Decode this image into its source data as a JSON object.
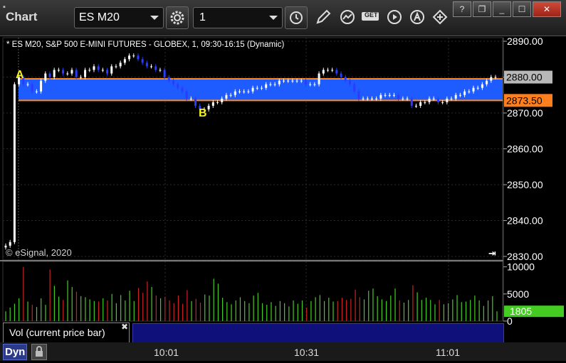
{
  "window": {
    "title": "Chart",
    "symbol": "ES M20",
    "interval": "1",
    "buttons": {
      "minimize": "_",
      "restore": "❐",
      "maximize": "☐",
      "close": "✕"
    }
  },
  "toolbar": {
    "tools": [
      "gear-icon",
      "clock-icon",
      "pencil-icon",
      "studies-icon",
      "get-icon",
      "play-icon",
      "alert-icon",
      "move-icon"
    ],
    "get_label": "GET"
  },
  "chart_data": [
    {
      "type": "candlestick",
      "header": "* ES M20, S&P 500 E-MINI FUTURES - GLOBEX, 1, 09:30-16:15 (Dynamic)",
      "copyright": "© eSignal, 2020",
      "y_ticks": [
        "2890.00",
        "2880.00",
        "2870.00",
        "2860.00",
        "2850.00",
        "2840.00",
        "2830.00"
      ],
      "y_tick_values": [
        2890,
        2880,
        2870,
        2860,
        2850,
        2840,
        2830
      ],
      "ylim": [
        2829,
        2891
      ],
      "x_ticks": [
        "10:01",
        "10:31",
        "11:01"
      ],
      "zone": {
        "upper": 2879.5,
        "lower": 2873.5,
        "color": "#1e5cff",
        "line_color": "#ff8a1e"
      },
      "price_tags": [
        {
          "label": "2880.00",
          "value": 2880.0,
          "bg": "#b8b8b8",
          "fg": "#000000"
        },
        {
          "label": "2873.50",
          "value": 2873.5,
          "bg": "#ff7f1e",
          "fg": "#000000"
        }
      ],
      "annotations": [
        {
          "text": "A",
          "color": "#f5f21e"
        },
        {
          "text": "B",
          "color": "#f5f21e"
        }
      ],
      "closes": [
        2833,
        2834,
        2878,
        2880,
        2878,
        2878,
        2876,
        2876,
        2879,
        2881,
        2880,
        2882,
        2882,
        2881,
        2881,
        2882,
        2880,
        2880,
        2882,
        2882,
        2883,
        2882,
        2882,
        2881,
        2883,
        2883,
        2884,
        2885,
        2886,
        2886,
        2885,
        2884,
        2883,
        2883,
        2882,
        2882,
        2880,
        2879,
        2878,
        2877,
        2876,
        2874,
        2874,
        2872,
        2871,
        2871,
        2872,
        2873,
        2873,
        2874,
        2875,
        2875,
        2876,
        2876,
        2876,
        2876,
        2877,
        2877,
        2877,
        2878,
        2878,
        2878,
        2879,
        2879,
        2879,
        2879,
        2879,
        2879,
        2878,
        2878,
        2878,
        2881,
        2882,
        2882,
        2882,
        2881,
        2880,
        2879,
        2878,
        2876,
        2874,
        2874,
        2874,
        2874,
        2874,
        2875,
        2875,
        2875,
        2875,
        2874,
        2874,
        2874,
        2872,
        2872,
        2873,
        2873,
        2874,
        2874,
        2873,
        2873,
        2874,
        2874,
        2875,
        2875,
        2876,
        2876,
        2877,
        2877,
        2878,
        2879,
        2880,
        2880
      ]
    },
    {
      "type": "bar",
      "title": "Vol (current price bar)",
      "y_ticks": [
        "10000",
        "5000",
        "0"
      ],
      "y_tick_values": [
        10000,
        5000,
        0
      ],
      "ylim": [
        0,
        11000
      ],
      "current_value_label": "1805",
      "current_value": 1805,
      "up_color": "#44cc22",
      "down_color": "#cc2222",
      "values": [
        1800,
        2500,
        3200,
        4200,
        10000,
        3600,
        3000,
        2600,
        4200,
        3000,
        9500,
        6500,
        4500,
        3900,
        7500,
        6300,
        5400,
        4600,
        4400,
        4000,
        3700,
        3600,
        4200,
        3800,
        5000,
        3300,
        4800,
        3800,
        5600,
        3700,
        6100,
        5200,
        7300,
        6300,
        4700,
        4200,
        4500,
        3800,
        3300,
        4700,
        3200,
        5700,
        3700,
        4100,
        3400,
        4900,
        4700,
        7800,
        6900,
        4300,
        3500,
        3100,
        3800,
        4400,
        3700,
        3300,
        4700,
        5200,
        3300,
        3000,
        3500,
        2800,
        3700,
        3300,
        2700,
        3800,
        3200,
        3800,
        2500,
        3700,
        4400,
        4800,
        3700,
        4300,
        3600,
        3700,
        4300,
        3900,
        4100,
        5800,
        4400,
        4000,
        5600,
        6000,
        4600,
        4000,
        3700,
        4700,
        6000,
        3800,
        3400,
        3900,
        6600,
        5300,
        3900,
        4300,
        3900,
        3100,
        3900,
        3100,
        3300,
        4000,
        4800,
        3500,
        3600,
        3900,
        4700,
        3800,
        2800,
        3800,
        4600,
        1805
      ]
    }
  ],
  "vol_panel": {
    "title": "Vol (current price bar)"
  },
  "status_bar": {
    "mode": "Dyn",
    "times": [
      "10:01",
      "10:31",
      "11:01"
    ]
  }
}
